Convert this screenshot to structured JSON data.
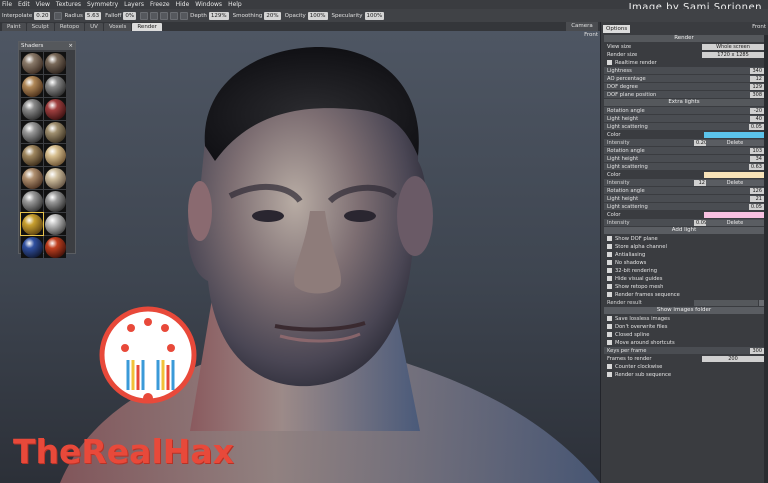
{
  "menu": [
    "File",
    "Edit",
    "View",
    "Textures",
    "Symmetry",
    "Layers",
    "Freeze",
    "Hide",
    "Windows",
    "Help"
  ],
  "credit": "Image by Sami Sorjonen",
  "toolbar": {
    "interpolate_label": "Interpolate",
    "interpolate_val": "0.20",
    "radius_label": "Radius",
    "radius_val": "5.63",
    "falloff_label": "Falloff",
    "falloff_val": "0%",
    "depth_label": "Depth",
    "depth_val": "129%",
    "smoothing_label": "Smoothing",
    "smoothing_val": "20%",
    "opacity_label": "Opacity",
    "opacity_val": "100%",
    "specularity_label": "Specularity",
    "specularity_val": "100%"
  },
  "tabs": [
    "Paint",
    "Sculpt",
    "Retopo",
    "UV",
    "Voxels",
    "Render"
  ],
  "camera_label": "Camera",
  "viewport_label": "Front",
  "shaders_title": "Shaders",
  "shader_colors": [
    [
      "#8a7a6a",
      "#3a2a20"
    ],
    [
      "#7a6a5a",
      "#2a201a"
    ],
    [
      "#b08858",
      "#4a2e18"
    ],
    [
      "#8a8a8a",
      "#2a2a2a"
    ],
    [
      "#8a8a8a",
      "#2a2a2a"
    ],
    [
      "#a04040",
      "#3a1010"
    ],
    [
      "#9a9a9a",
      "#303030"
    ],
    [
      "#a09070",
      "#3a3020"
    ],
    [
      "#a08860",
      "#3a2a18"
    ],
    [
      "#d8c090",
      "#6a5030"
    ],
    [
      "#b09070",
      "#4a3020"
    ],
    [
      "#d0c0a0",
      "#605040"
    ],
    [
      "#9a9a9a",
      "#303030"
    ],
    [
      "#9a9a9a",
      "#2a2a2a"
    ],
    [
      "#c8a030",
      "#5a4010"
    ],
    [
      "#c0c0c0",
      "#404040"
    ],
    [
      "#3050a0",
      "#101830"
    ],
    [
      "#c04020",
      "#401008"
    ]
  ],
  "logo_text": "TheRealHax",
  "options": {
    "tab": "Options",
    "front": "Front",
    "render_section": "Render",
    "view_size_label": "View size",
    "view_size_val": "Whole screen",
    "render_size_label": "Render size",
    "render_size_val": "1720 x 1285",
    "realtime_label": "Realtime render",
    "sliders": [
      {
        "label": "Lightness",
        "value": "340"
      },
      {
        "label": "AO percentage",
        "value": "12"
      },
      {
        "label": "DOF degree",
        "value": "129"
      },
      {
        "label": "DOF plane position",
        "value": "308"
      }
    ],
    "extra_lights": "Extra lights",
    "lights": [
      {
        "angle": "-20",
        "height": "40",
        "scatter": "0.05",
        "color": "#5bc3ea",
        "intensity": "0.20"
      },
      {
        "angle": "103",
        "height": "34",
        "scatter": "0.63",
        "color": "#f7e2b8",
        "intensity": "12"
      },
      {
        "angle": "126",
        "height": "21",
        "scatter": "0.05",
        "color": "#f7c0e0",
        "intensity": "0.09"
      }
    ],
    "rotation_angle": "Rotation angle",
    "light_height": "Light height",
    "light_scattering": "Light scattering",
    "color": "Color",
    "intensity": "Intensity",
    "delete": "Delete",
    "add_light": "Add light",
    "checks": [
      "Show DOF plane",
      "Store alpha channel",
      "Antialiasing",
      "No shadows",
      "32-bit rendering",
      "Hide visual guides",
      "Show retopo mesh",
      "Render frames sequence"
    ],
    "render_result": "Render result",
    "show_images_folder": "Show images folder",
    "checks2": [
      "Save lossless images",
      "Don't overwrite files",
      "Closed spline",
      "Move around shortcuts"
    ],
    "keys_per_frame_label": "Keys per frame",
    "keys_per_frame_val": "300",
    "frames_to_render_label": "Frames to render",
    "frames_to_render_val": "200",
    "checks3": [
      "Counter clockwise",
      "Render sub sequence"
    ]
  }
}
